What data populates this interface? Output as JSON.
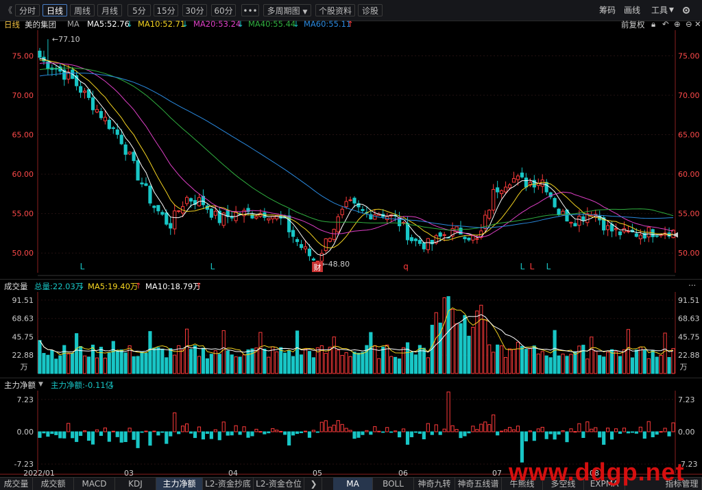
{
  "toolbar": {
    "back": "《",
    "periods": [
      "分时",
      "日线",
      "周线",
      "月线",
      "5分",
      "15分",
      "30分",
      "60分"
    ],
    "active_period": "日线",
    "more": "•••",
    "multi": "多周期图",
    "profile": "个股资料",
    "diagnose": "诊股",
    "right": [
      "筹码",
      "画线",
      "工具"
    ]
  },
  "ma_line": {
    "label": "日线",
    "stock": "美的集团",
    "ma": "MA",
    "ma5": "MA5:52.76",
    "ma10": "MA10:52.71",
    "ma20": "MA20:53.24",
    "ma40": "MA40:55.44",
    "ma60": "MA60:55.11",
    "adjust": "前复权"
  },
  "vol_head": {
    "label": "成交量",
    "total": "总量:22.03万",
    "ma5": "MA5:19.40万",
    "ma10": "MA10:18.79万"
  },
  "flow_head": {
    "label": "主力净额",
    "value": "主力净额:-0.11亿"
  },
  "colors": {
    "up": "#ff3b3b",
    "down": "#18c6c6",
    "ma5": "#ffffff",
    "ma10": "#f5d420",
    "ma20": "#e040c8",
    "ma40": "#30b040",
    "ma60": "#2a8ae0",
    "grid": "#2a1010",
    "axis": "#8b2020"
  },
  "chart_data": [
    {
      "type": "candlestick",
      "title": "美的集团 日线",
      "y_ticks": [
        75.0,
        70.0,
        65.0,
        60.0,
        55.0,
        50.0
      ],
      "ylim": [
        47.5,
        77.9
      ],
      "x_ticks": [
        "2022/01",
        "03",
        "04",
        "05",
        "06",
        "07",
        "08"
      ],
      "annotations": {
        "high": "77.10",
        "low": "48.80",
        "marks": [
          "L",
          "L",
          "财",
          "q",
          "L",
          "L",
          "L"
        ]
      },
      "ohlc_anchor_closes": [
        74.5,
        73.4,
        72.0,
        69.5,
        67.0,
        64.5,
        60.0,
        56.0,
        53.5,
        57.0,
        56.5,
        54.2,
        55.0,
        55.0,
        55.2,
        54.0,
        51.0,
        48.9,
        53.0,
        56.2,
        55.0,
        55.2,
        54.2,
        51.5,
        51.0,
        52.5,
        52.8,
        51.4,
        58.0,
        59.5,
        58.9,
        59.3,
        55.0,
        54.2,
        55.5,
        53.0,
        52.4,
        52.5,
        52.8,
        52.9
      ]
    },
    {
      "type": "bar",
      "title": "成交量",
      "unit": "万",
      "y_ticks": [
        91.51,
        68.63,
        45.75,
        22.88
      ],
      "ylim": [
        0,
        100
      ]
    },
    {
      "type": "bar",
      "title": "主力净额",
      "y_ticks": [
        7.23,
        0.0,
        -7.23
      ],
      "ylim": [
        -9.2,
        9.2
      ]
    }
  ],
  "bottom_tabs": {
    "left": [
      "成交量",
      "成交额",
      "MACD",
      "KDJ",
      "主力净额",
      "L2-资金抄底",
      "L2-资金仓位"
    ],
    "right": [
      "MA",
      "BOLL",
      "神奇九转",
      "神奇五线谱",
      "牛熊线",
      "多空线",
      "EXPMA",
      "指标管理"
    ],
    "active_left": "主力净额",
    "active_right": "MA",
    "arrow": "❯"
  },
  "watermark": "www.ddgp.net"
}
